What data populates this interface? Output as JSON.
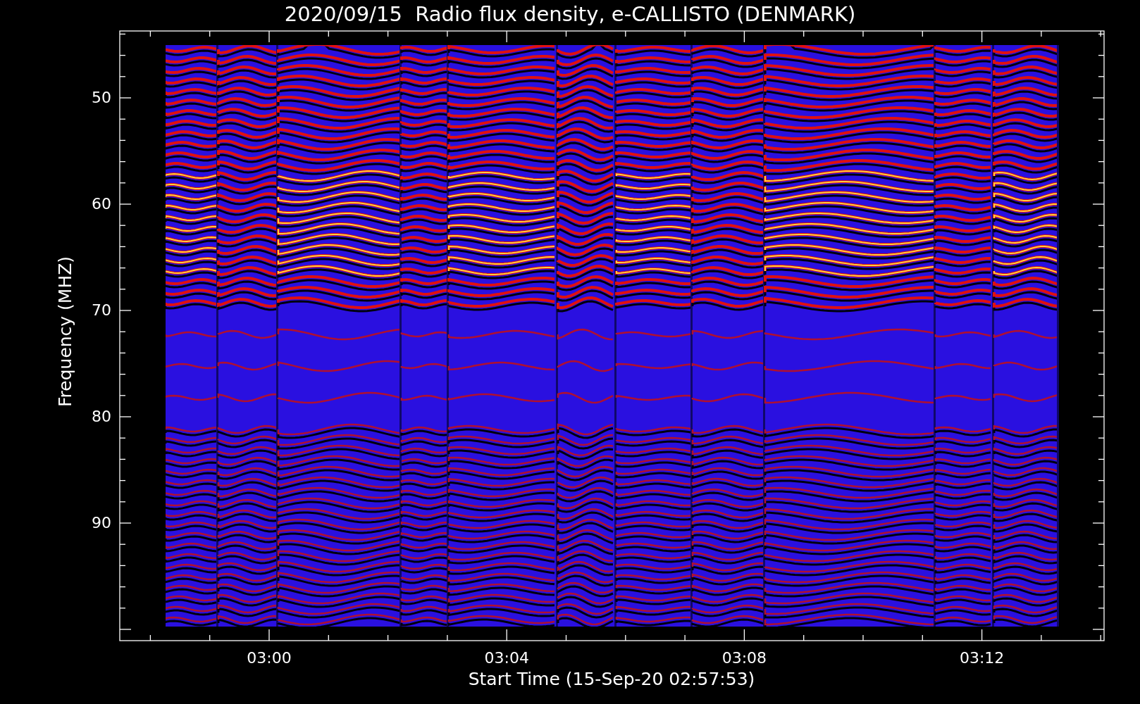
{
  "title": "2020/09/15  Radio flux density, e-CALLISTO (DENMARK)",
  "plot": {
    "ylabel": "Frequency (MHZ)",
    "xlabel": "Start Time (15-Sep-20 02:57:53)",
    "yticks": [
      "50",
      "60",
      "70",
      "80",
      "90"
    ],
    "xticks": [
      "03:00",
      "03:04",
      "03:08",
      "03:12"
    ]
  }
}
